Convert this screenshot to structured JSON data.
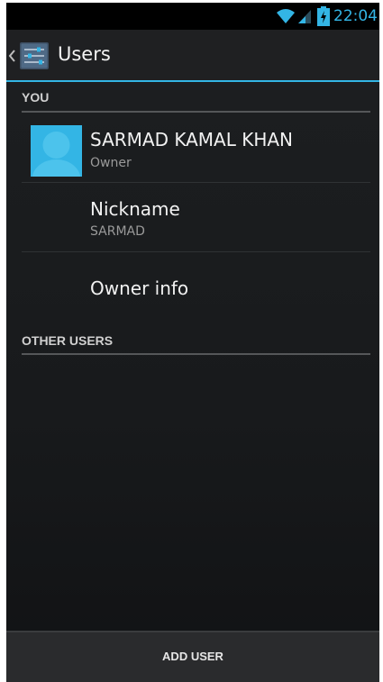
{
  "status_bar": {
    "time": "22:04",
    "icons": [
      "wifi-icon",
      "signal-icon",
      "battery-charging-icon"
    ]
  },
  "action_bar": {
    "title": "Users",
    "up_icon": "chevron-left-icon",
    "app_icon": "settings-sliders-icon"
  },
  "you_section": {
    "header": "YOU",
    "owner": {
      "name": "SARMAD KAMAL KHAN",
      "role": "Owner",
      "avatar_icon": "default-user-avatar-icon"
    },
    "nickname": {
      "label": "Nickname",
      "value": "SARMAD"
    },
    "owner_info": {
      "label": "Owner info"
    }
  },
  "other_users_section": {
    "header": "OTHER USERS"
  },
  "bottom_bar": {
    "add_user_label": "ADD USER"
  },
  "colors": {
    "accent": "#33b5e5",
    "background": "#1a1c1e",
    "primary_text": "#f2f2f2",
    "secondary_text": "#9a9a9a"
  }
}
